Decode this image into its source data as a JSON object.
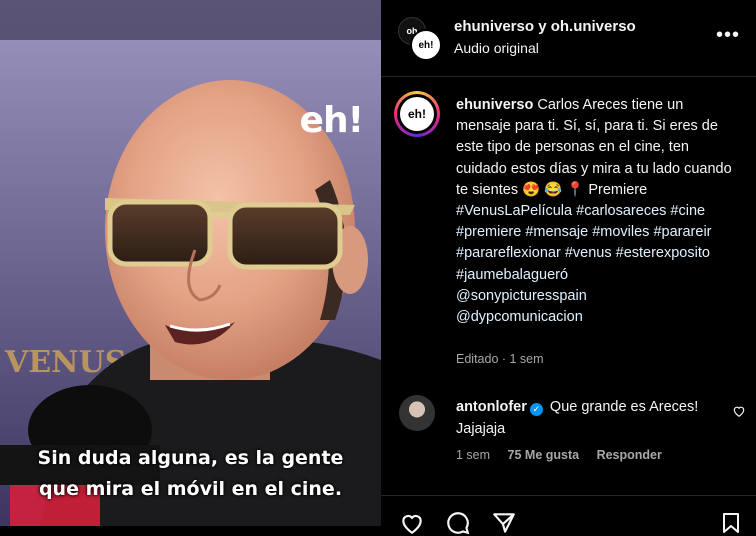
{
  "media": {
    "watermark": "eh!",
    "backdrop_text": "VENUS",
    "subtitle_lines": [
      "Sin duda alguna, es la gente",
      "que mira el móvil en el cine."
    ]
  },
  "header": {
    "title": "ehuniverso y oh.universo",
    "subtitle": "Audio original",
    "avatar_text_1": "oh",
    "avatar_text_2": "eh!",
    "more_icon": "more-horizontal-icon"
  },
  "caption": {
    "avatar_text": "eh!",
    "username": "ehuniverso",
    "text": "Carlos Areces tiene un mensaje para ti. Sí, sí, para ti. Si eres de este tipo de personas en el cine, ten cuidado estos días y mira a tu lado cuando te sientes 😍 😂 📍 Premiere",
    "hashtags": [
      "#VenusLaPelícula",
      "#carlosareces",
      "#cine",
      "#premiere",
      "#mensaje",
      "#moviles",
      "#parareir",
      "#parareflexionar",
      "#venus",
      "#esterexposito",
      "#jaumebalagueró"
    ],
    "mentions": [
      "@sonypicturesspain",
      "@dypcomunicacion"
    ],
    "meta": "Editado · 1 sem"
  },
  "comment": {
    "username": "antonlofer",
    "verified": true,
    "text": "Que grande es Areces! Jajajaja",
    "time": "1 sem",
    "likes": "75 Me gusta",
    "reply": "Responder"
  },
  "actions": {
    "icons": [
      "heart-icon",
      "comment-icon",
      "share-icon",
      "bookmark-icon"
    ]
  },
  "colors": {
    "background": "#000000",
    "text": "#f5f5f5",
    "muted": "#a8a8a8",
    "link": "#e0f1ff",
    "verified": "#0095f6",
    "divider": "#262626"
  }
}
